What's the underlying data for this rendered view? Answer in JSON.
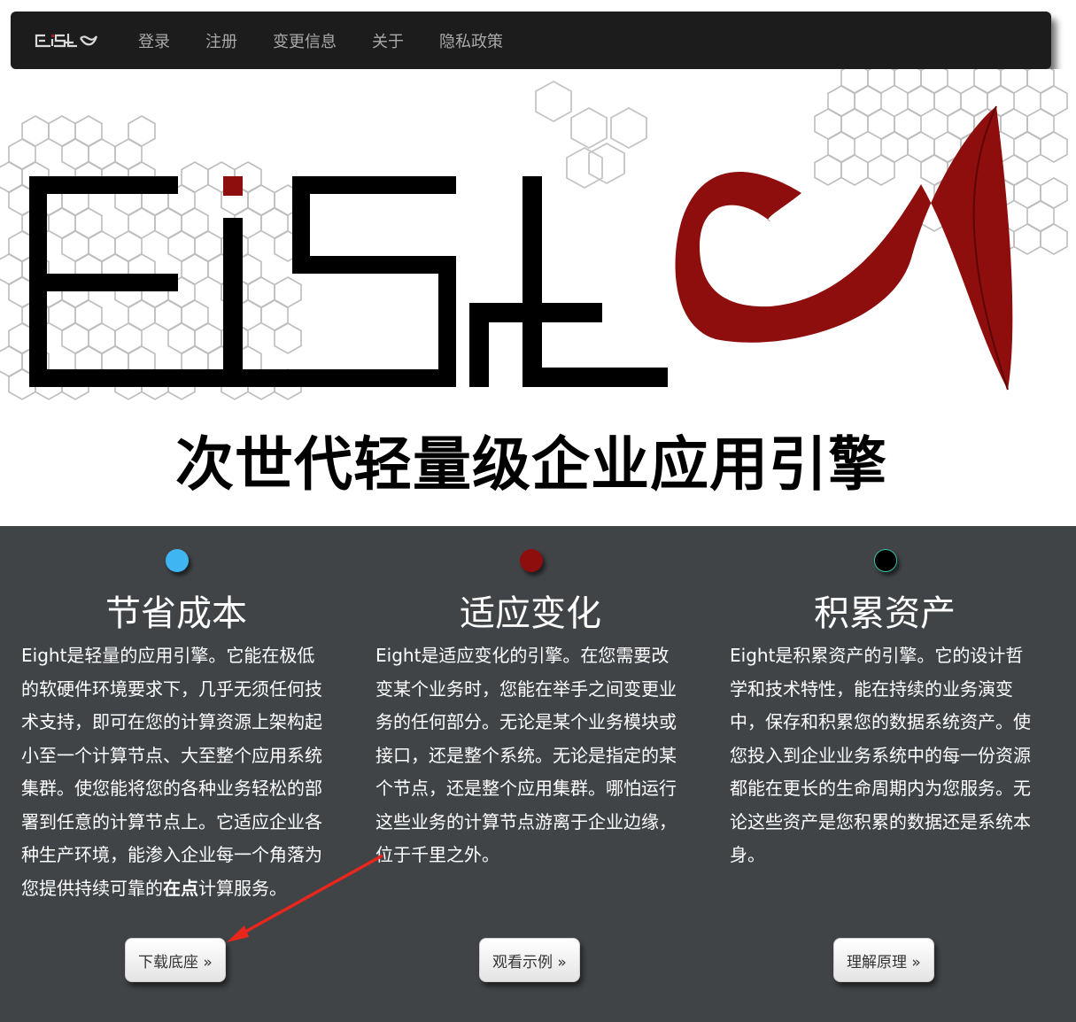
{
  "brand": {
    "logo_text": "EiSH"
  },
  "nav": {
    "items": [
      {
        "label": "登录"
      },
      {
        "label": "注册"
      },
      {
        "label": "变更信息"
      },
      {
        "label": "关于"
      },
      {
        "label": "隐私政策"
      }
    ]
  },
  "hero": {
    "logo_text": "EiSH",
    "slogan": "次世代轻量级企业应用引擎"
  },
  "features": [
    {
      "dot_color": "#3fb5f2",
      "title": "节省成本",
      "text_before": "Eight是轻量的应用引擎。它能在极低的软硬件环境要求下，几乎无须任何技术支持，即可在您的计算资源上架构起小至一个计算节点、大至整个应用系统集群。使您能将您的各种业务轻松的部署到任意的计算节点上。它适应企业各种生产环境，能渗入企业每一个角落为您提供持续可靠的",
      "text_bold": "在点",
      "text_after": "计算服务。",
      "button": "下载底座 »"
    },
    {
      "dot_color": "#8e0d0d",
      "title": "适应变化",
      "text_before": "Eight是适应变化的引擎。在您需要改变某个业务时，您能在举手之间变更业务的任何部分。无论是某个业务模块或接口，还是整个系统。无论是指定的某个节点，还是整个应用集群。哪怕运行这些业务的计算节点游离于企业边缘，位于千里之外。",
      "text_bold": "",
      "text_after": "",
      "button": "观看示例 »"
    },
    {
      "dot_color": "#000000",
      "title": "积累资产",
      "text_before": "Eight是积累资产的引擎。它的设计哲学和技术特性，能在持续的业务演变中，保存和积累您的数据系统资产。使您投入到企业业务系统中的每一份资源都能在更长的生命周期内为您服务。无论这些资产是您积累的数据还是系统本身。",
      "text_bold": "",
      "text_after": "",
      "button": "理解原理 »"
    }
  ],
  "colors": {
    "navbar_bg": "#1c1c1c",
    "nav_text": "#a9a9a9",
    "features_bg": "#404447",
    "logo_red": "#8e0d0d",
    "annotation_arrow": "#e8261c"
  }
}
